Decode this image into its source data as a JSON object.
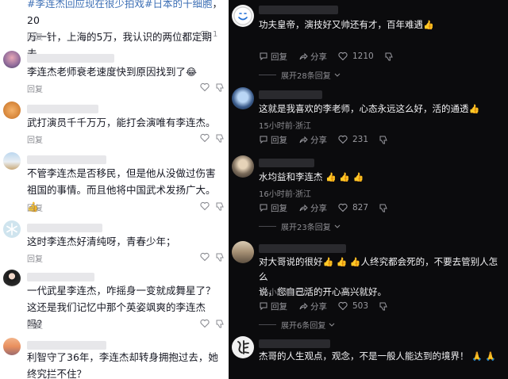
{
  "left": {
    "top_comment": {
      "hashtag1": "#李连杰回应现在很少拍戏",
      "hashtag2": "#日本的干细胞",
      "text_rest_line1": "，20",
      "text_line2": "万一针，上海的5万，我认识的两位都定期去。",
      "reply": "回复",
      "likes": "1"
    },
    "comments": [
      {
        "text": "李连杰老师衰老速度快到原因找到了",
        "emoji": "😂",
        "reply": "回复"
      },
      {
        "text": "武打演员千千万万，能打会演唯有李连杰。",
        "reply": "回复"
      },
      {
        "text": "不管李连杰是否移民，但是他从没做过伤害祖国的事情。而且他将中国武术发扬广大。",
        "emoji": "👍",
        "reply": "回复"
      },
      {
        "text": "这时李连杰好清纯呀，青春少年；",
        "reply": "回复"
      },
      {
        "text": "一代武星李连杰，咋摇身一变就成舞星了？这还是我们记忆中那个英姿飒爽的李连杰吗？",
        "reply": "回复"
      },
      {
        "text": "利智守了36年，李连杰却转身拥抱过去，她终究拦不住？"
      }
    ]
  },
  "right": {
    "comments": [
      {
        "text": "功夫皇帝，演技好又帅还有才，百年难遇",
        "emoji": "👍",
        "reply": "回复",
        "share": "分享",
        "likes": "1210",
        "expand": "展开28条回复"
      },
      {
        "text": "这就是我喜欢的李老师，心态永远这么好，活的通透",
        "emoji": "👍",
        "meta": "15小时前·浙江",
        "reply": "回复",
        "share": "分享",
        "likes": "231"
      },
      {
        "text": "水均益和李连杰",
        "emoji": "👍 👍 👍",
        "meta": "16小时前·浙江",
        "reply": "回复",
        "share": "分享",
        "likes": "827",
        "expand": "展开23条回复"
      },
      {
        "text_part1": "对大哥说的很好",
        "emoji": "👍 👍 👍",
        "text_part2": "人终究都会死的，不要去管别人怎么",
        "text_line2": "说，您自己活的开心高兴就好。",
        "meta": "15小时前·四川",
        "reply": "回复",
        "share": "分享",
        "likes": "503",
        "expand": "展开6条回复"
      },
      {
        "text": "杰哥的人生观点，观念，不是一般人能达到的境界！",
        "emoji": "🙏 🙏"
      }
    ]
  },
  "colors": {
    "hashtag": "#3d6fb5",
    "light_bg": "#ffffff",
    "dark_bg": "#0b0b0d"
  }
}
